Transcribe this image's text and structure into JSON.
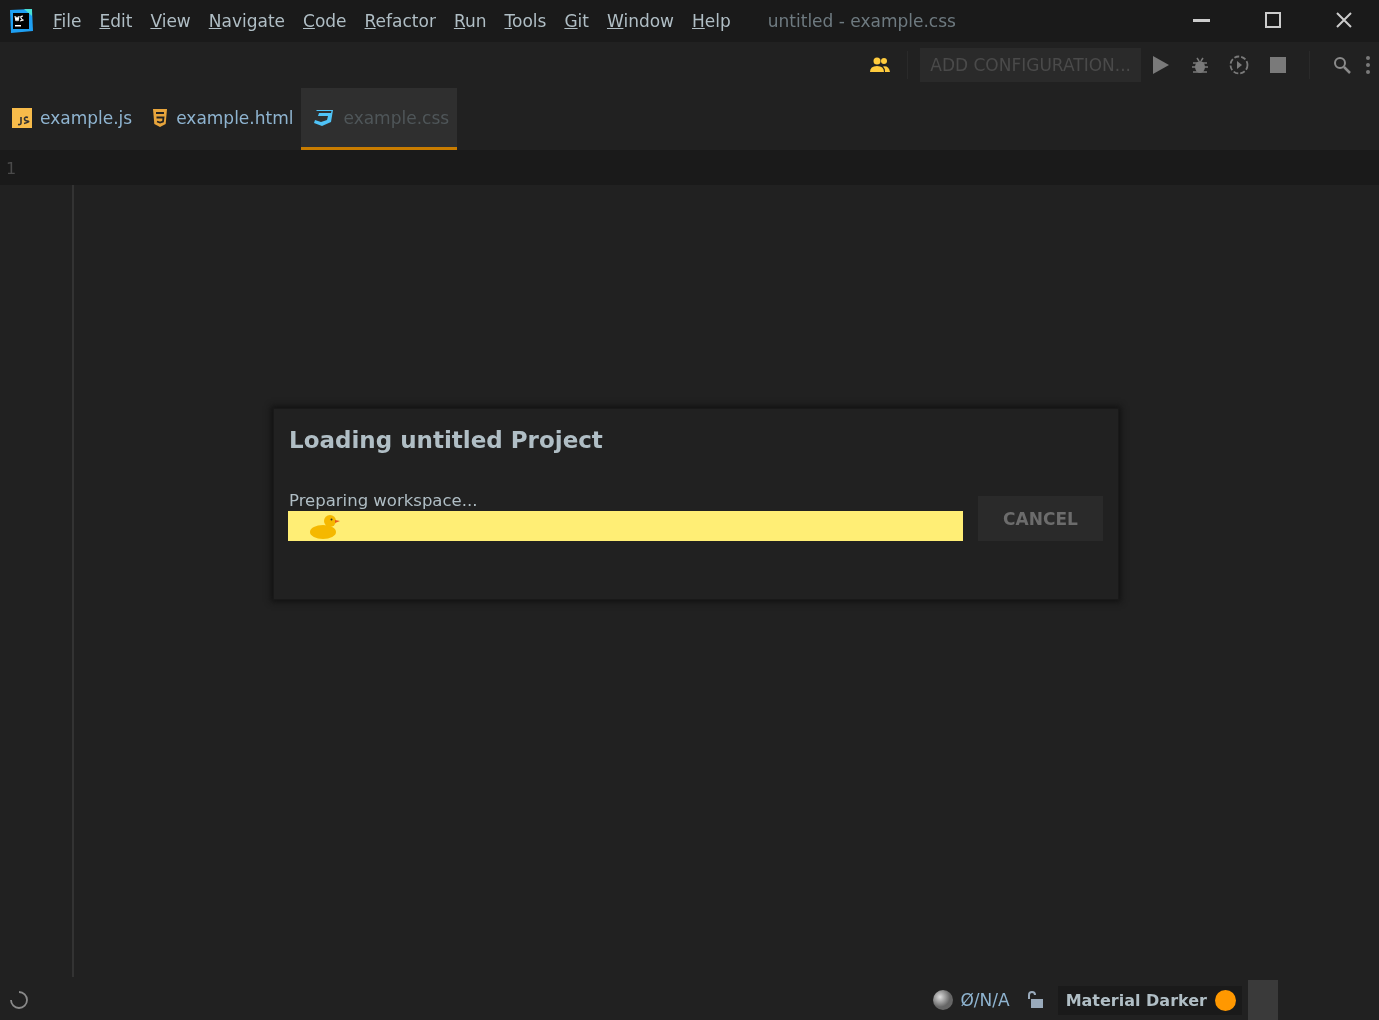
{
  "menu": [
    "File",
    "Edit",
    "View",
    "Navigate",
    "Code",
    "Refactor",
    "Run",
    "Tools",
    "Git",
    "Window",
    "Help"
  ],
  "window": {
    "title": "untitled - example.css"
  },
  "toolbar": {
    "configuration": "ADD CONFIGURATION..."
  },
  "tabs": [
    {
      "label": "example.js",
      "kind": "js",
      "selected": false
    },
    {
      "label": "example.html",
      "kind": "html",
      "selected": false
    },
    {
      "label": "example.css",
      "kind": "css",
      "selected": true
    }
  ],
  "editor": {
    "line_numbers": [
      "1"
    ]
  },
  "dialog": {
    "title": "Loading untitled Project",
    "message": "Preparing workspace...",
    "level": 1,
    "cancel": "CANCEL"
  },
  "status_bar": {
    "vcs": "Ø/N/A",
    "theme": "Material Darker"
  }
}
